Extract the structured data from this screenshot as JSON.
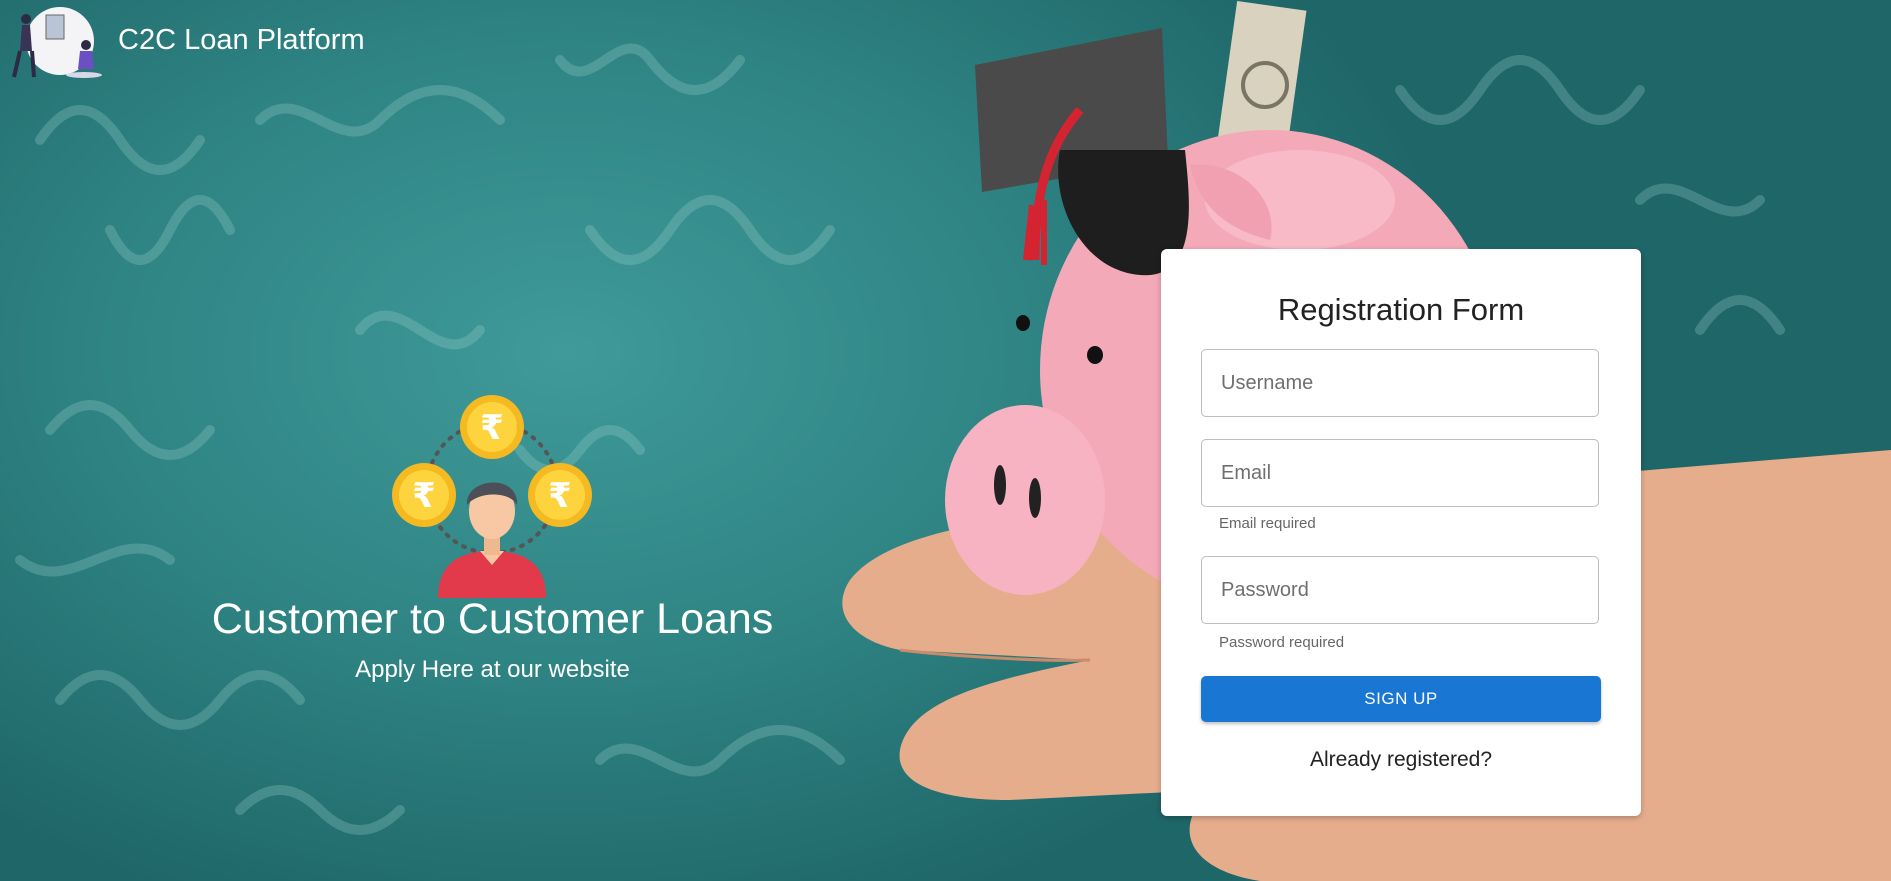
{
  "header": {
    "title": "C2C Loan Platform"
  },
  "hero": {
    "title": "Customer to Customer Loans",
    "subtitle": "Apply Here at our website",
    "coin_symbol": "₹"
  },
  "form": {
    "title": "Registration Form",
    "username_placeholder": "Username",
    "email_placeholder": "Email",
    "email_helper": "Email required",
    "password_placeholder": "Password",
    "password_helper": "Password required",
    "signup_label": "SIGN UP",
    "already_label": "Already registered?"
  },
  "colors": {
    "primary": "#1976d2",
    "background": "#2f8586"
  }
}
